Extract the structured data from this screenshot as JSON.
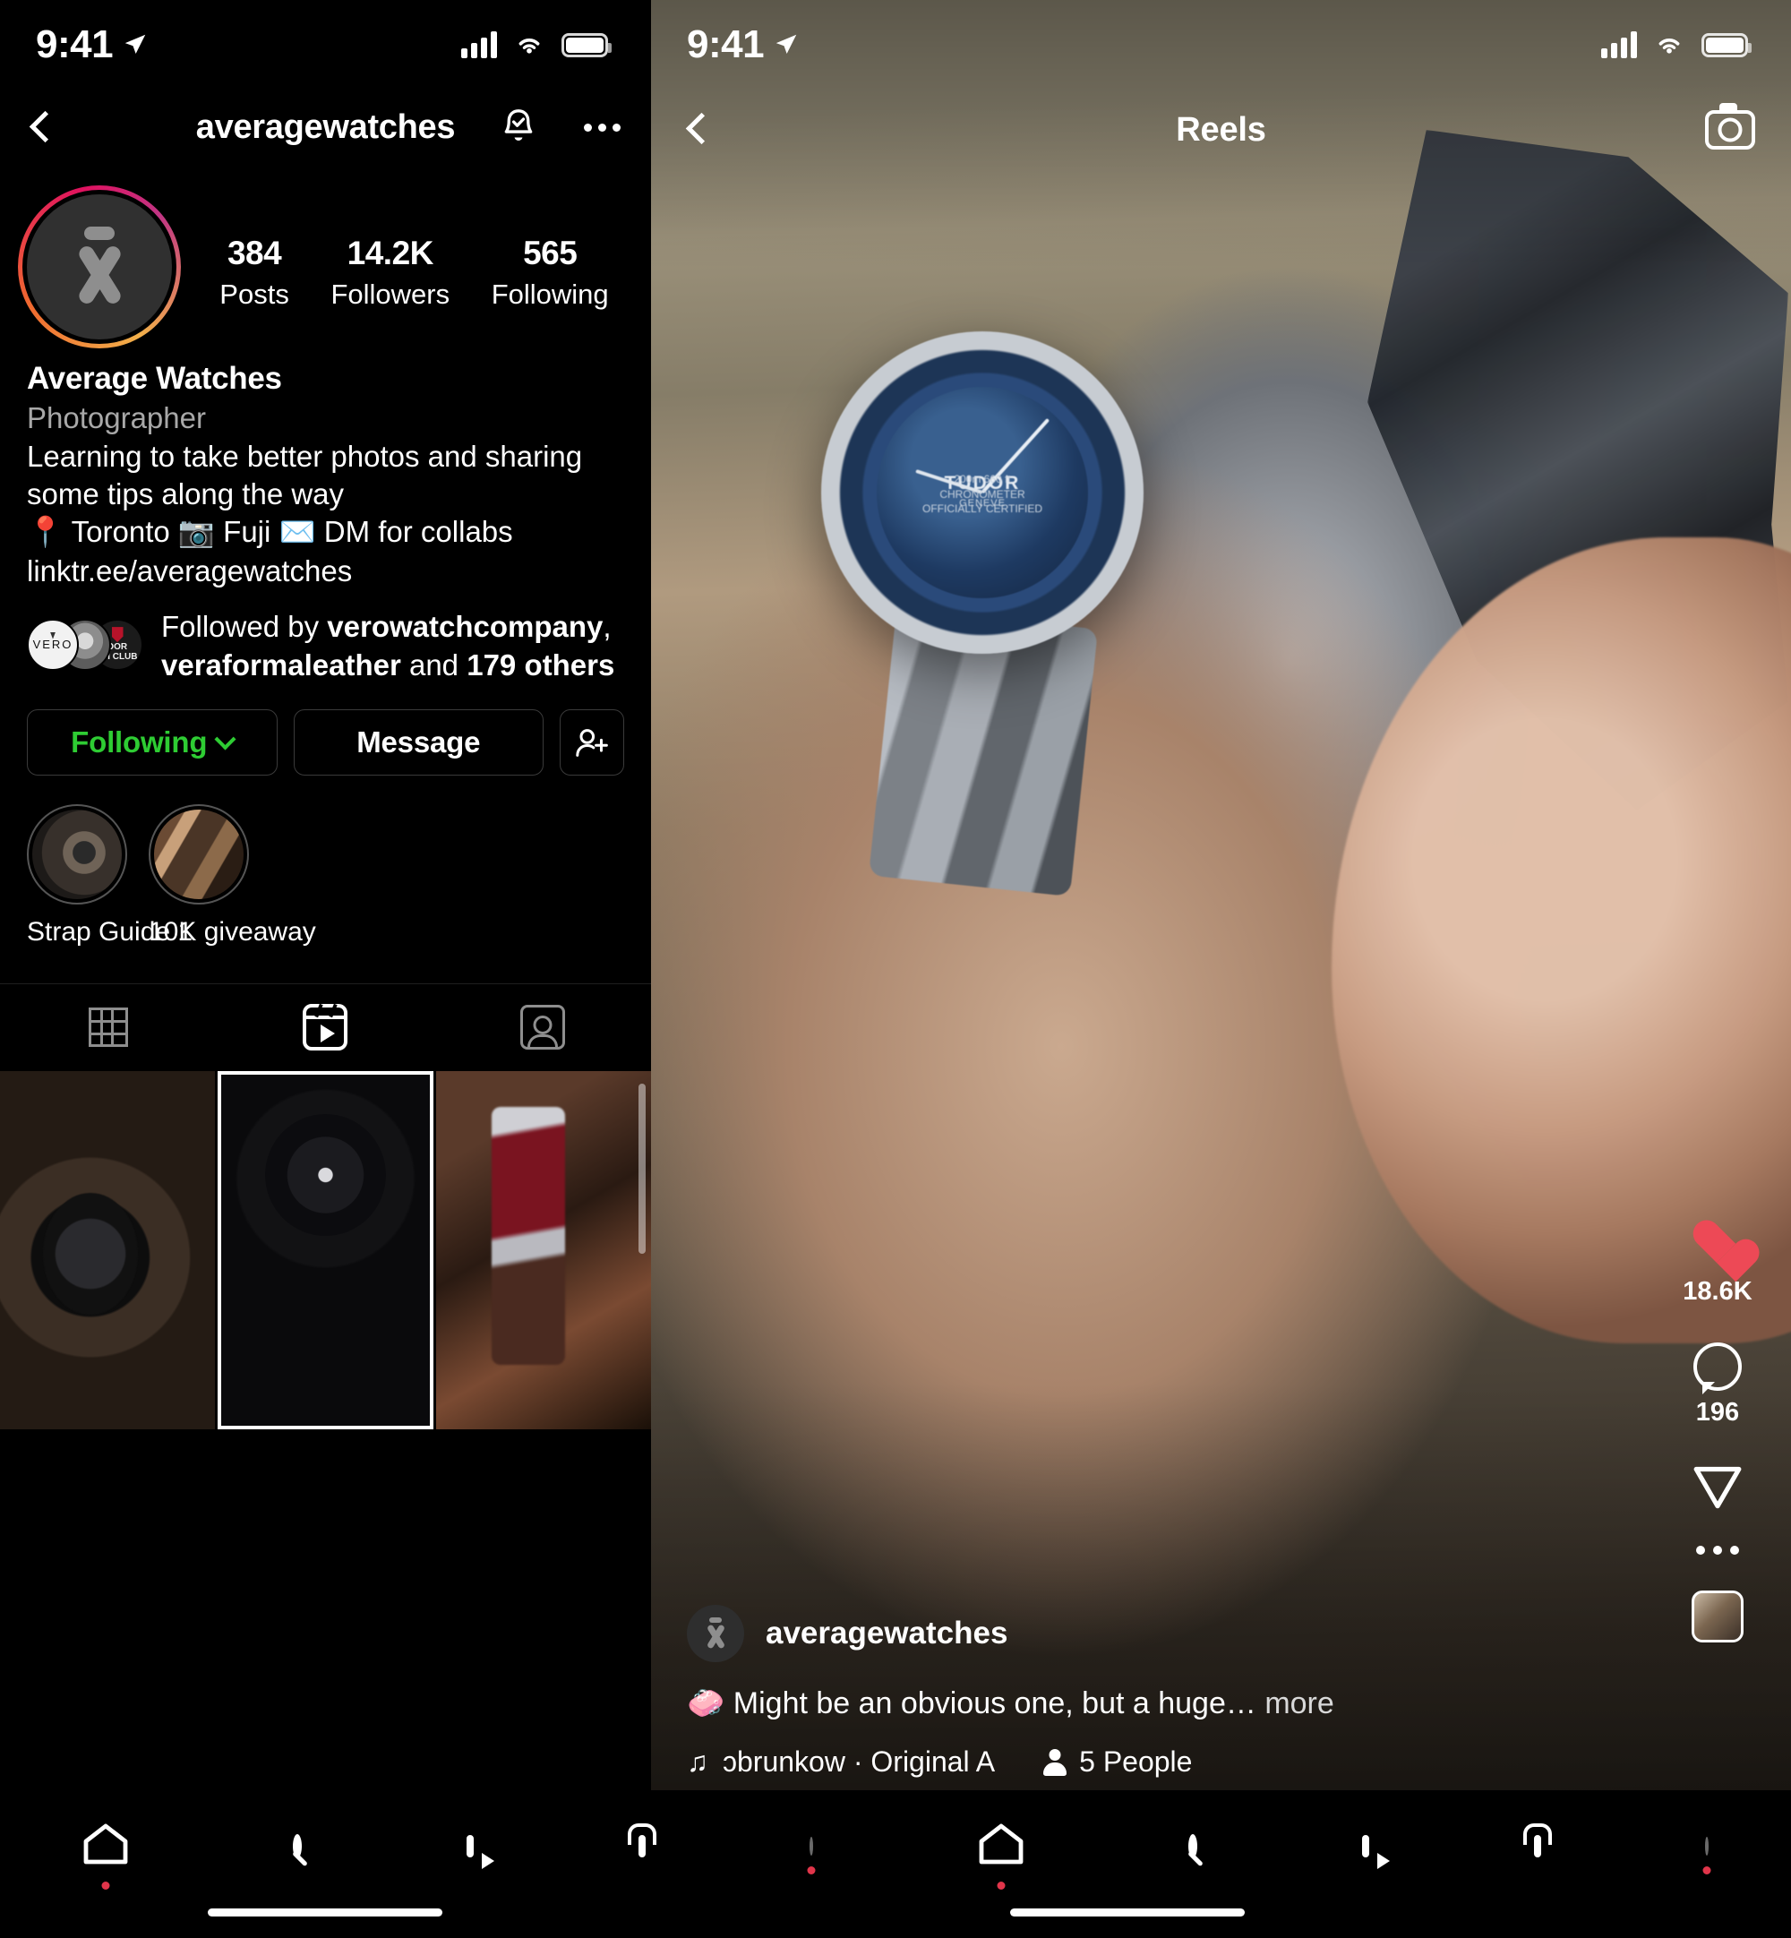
{
  "status_bar": {
    "time": "9:41",
    "location_icon": "location-arrow-icon",
    "signal_icon": "cellular-signal-icon",
    "wifi_icon": "wifi-icon",
    "battery_icon": "battery-full-icon"
  },
  "profile": {
    "nav": {
      "back_icon": "chevron-left-icon",
      "username": "averagewatches",
      "notify_icon": "bell-check-icon",
      "more_icon": "ellipsis-icon"
    },
    "avatar": {
      "has_story_ring": true,
      "ring_colors": [
        "#f2b04a",
        "#f06a2f",
        "#e0115f",
        "#c13584"
      ],
      "logo_glyph": "x-logo-icon"
    },
    "stats": [
      {
        "value": "384",
        "label": "Posts"
      },
      {
        "value": "14.2K",
        "label": "Followers"
      },
      {
        "value": "565",
        "label": "Following"
      }
    ],
    "bio": {
      "display_name": "Average Watches",
      "category": "Photographer",
      "text": "Learning to take better photos and sharing some tips along the way",
      "meta_line": "📍 Toronto 📷 Fuji ✉️ DM for collabs",
      "link": "linktr.ee/averagewatches"
    },
    "followed_by": {
      "prefix": "Followed by ",
      "first_user": "verowatchcompany",
      "separator": ", ",
      "second_user": "veraformaleather",
      "and": " and ",
      "others": "179 others",
      "avatars": [
        {
          "name": "vero-avatar",
          "label": "VERO"
        },
        {
          "name": "skull-coin-avatar",
          "label": ""
        },
        {
          "name": "dor-club-avatar",
          "label": "DOR\nCH CLUB"
        }
      ]
    },
    "actions": {
      "following_label": "Following",
      "following_color": "#2ecc33",
      "following_chevron": "chevron-down-icon",
      "message_label": "Message",
      "add_person_icon": "add-person-icon"
    },
    "highlights": [
      {
        "caption": "Strap Guide 1"
      },
      {
        "caption": "10K giveaway"
      }
    ],
    "content_tabs": [
      {
        "name": "grid",
        "icon": "grid-icon",
        "active": false
      },
      {
        "name": "reels",
        "icon": "reels-icon",
        "active": true
      },
      {
        "name": "tagged",
        "icon": "tagged-person-icon",
        "active": false
      }
    ],
    "media_cells": [
      {
        "name": "media-cell-1",
        "selected": false
      },
      {
        "name": "media-cell-2",
        "selected": true
      },
      {
        "name": "media-cell-3",
        "selected": false
      }
    ]
  },
  "reels": {
    "nav": {
      "back_icon": "chevron-left-icon",
      "title": "Reels",
      "camera_icon": "camera-icon"
    },
    "rail": [
      {
        "name": "like",
        "icon": "heart-icon",
        "count": "18.6K",
        "liked": true,
        "color": "#ed4956"
      },
      {
        "name": "comment",
        "icon": "comment-bubble-icon",
        "count": "196"
      },
      {
        "name": "share",
        "icon": "paper-plane-icon",
        "count": ""
      },
      {
        "name": "more",
        "icon": "ellipsis-icon",
        "count": ""
      },
      {
        "name": "audio-thumbnail",
        "icon": "audio-cover-thumbnail",
        "count": ""
      }
    ],
    "caption": {
      "avatar_icon": "x-logo-icon",
      "username": "averagewatches",
      "emoji": "🧼",
      "text": "Might be an obvious one, but a huge…",
      "more_label": " more",
      "audio_icon": "music-note-icon",
      "audio_label": "ɔbrunkow · Original A",
      "people_icon": "person-icon",
      "people_label": "5 People"
    }
  },
  "bottom_nav": {
    "left": [
      {
        "name": "home",
        "icon": "home-icon",
        "dot": true
      },
      {
        "name": "search",
        "icon": "search-icon",
        "dot": false
      },
      {
        "name": "reels",
        "icon": "reels-icon",
        "dot": false
      },
      {
        "name": "shop",
        "icon": "shop-bag-icon",
        "dot": false
      },
      {
        "name": "profile",
        "icon": "profile-avatar-icon",
        "dot": true
      }
    ],
    "right": [
      {
        "name": "home",
        "icon": "home-icon",
        "dot": true
      },
      {
        "name": "search",
        "icon": "search-icon",
        "dot": false
      },
      {
        "name": "reels",
        "icon": "reels-icon",
        "dot": false
      },
      {
        "name": "shop",
        "icon": "shop-bag-icon",
        "dot": false
      },
      {
        "name": "profile",
        "icon": "profile-avatar-icon",
        "dot": true
      }
    ]
  }
}
